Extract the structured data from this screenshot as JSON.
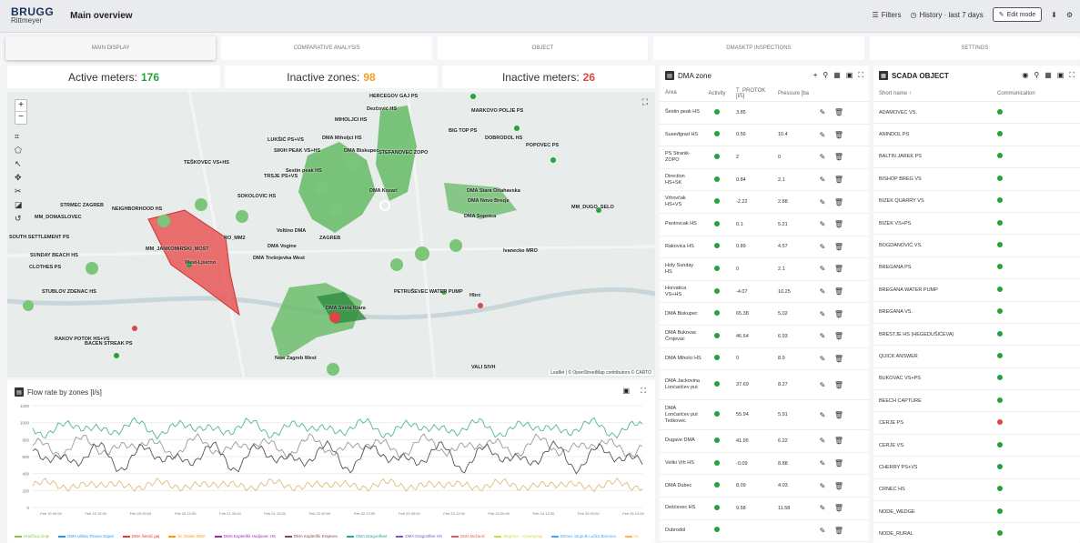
{
  "header": {
    "logo_top": "BRUGG",
    "logo_bottom": "Rittmeyer",
    "title": "Main overview",
    "filters_label": "Filters",
    "history_label": "History · last 7 days",
    "edit_mode_label": "Edit mode"
  },
  "tabs": [
    {
      "label": "MAIN DISPLAY"
    },
    {
      "label": "COMPARATIVE ANALYSIS"
    },
    {
      "label": "OBJECT"
    },
    {
      "label": "DMASKTP INSPECTIONS"
    },
    {
      "label": "SETTINGS"
    }
  ],
  "kpis": {
    "active_label": "Active meters:",
    "active_value": "176",
    "active_color": "#27a13a",
    "inactive_zones_label": "Inactive zones:",
    "inactive_zones_value": "98",
    "inactive_zones_color": "#f0a020",
    "inactive_meters_label": "Inactive meters:",
    "inactive_meters_value": "26",
    "inactive_meters_color": "#e04444"
  },
  "map": {
    "attribution": "Leaflet | © OpenStreetMap contributors © CARTO",
    "labels": [
      "HERCEGOV GAJ PS",
      "Dezčović HS",
      "MARKOVO POLJE PS",
      "MIHOLJCI HS",
      "BIG TOP PS",
      "DOBRODOL HS",
      "POPOVEC PS",
      "LUKŠIĆ PS+VS",
      "DMA Miholjci HS",
      "STEFANOVEC ZOPO",
      "SIKIH PEAK VS+HS",
      "DMA Biskupec",
      "TEŠKOVEC VS+HS",
      "TRSJE PS+VS",
      "Sestin peak HS",
      "DMA Stara Oriahavska",
      "STRMEC ZAGREB",
      "SOKOLOVIC HS",
      "DMA Kozari",
      "DMA Novo Brezje",
      "NEIGHBORHOOD HS",
      "MM_DOMASLOVEC",
      "DMA Sopnica",
      "MM_DUGO_SELO",
      "SOUTH SETTLEMENT PS",
      "RO_MM2",
      "Voltino DMA",
      "ZAGREB",
      "MM_JANKOMIRSKI_MOST",
      "DMA Vogine",
      "SUNDAY BEACH HS",
      "DMA Trešnjevka West",
      "Ivanecko MRO",
      "CLOTHES PS",
      "West-Ljsicno",
      "PETRUŠEVEC WATER PUMP",
      "STUBLOV ZDENAC HS",
      "Hbrc",
      "RAKOV POTOK HS+VS",
      "BACEN STREAK PS",
      "New Zagreb West",
      "VALI SIVH",
      "DMA Sveta Klara"
    ]
  },
  "flow": {
    "title": "Flow rate by zones [l/s]",
    "y_ticks": [
      "1200",
      "1000",
      "800",
      "600",
      "400",
      "200",
      "0"
    ],
    "x_ticks": [
      "Feb 19 00:00",
      "Feb 19 12:00",
      "Feb 20 00:00",
      "Feb 20 12:00",
      "Feb 21 00:00",
      "Feb 21 12:00",
      "Feb 22 00:00",
      "Feb 22 12:00",
      "Feb 23 00:00",
      "Feb 23 12:00",
      "Feb 24 00:00",
      "Feb 24 12:00",
      "Feb 25 00:00",
      "Feb 25 12:00"
    ],
    "legend": [
      "Hraščica Grije",
      "DMA Ulitna Trnovo Sopot",
      "DMA Šestić gaj",
      "St. Grabri DMA",
      "DMA Kuplerški Hodjovec HS",
      "DMA Kuplerški Krajevec",
      "DMA Dragonfleet",
      "DMA Dragonflee HS",
      "DMA Božanić",
      "Stoprica - st pumping",
      "Strmec Stupnik Lučko Brezovo",
      "5x"
    ],
    "legend_colors": [
      "#8bc34a",
      "#2196f3",
      "#e53935",
      "#ff9800",
      "#9c27b0",
      "#795548",
      "#26a69a",
      "#7e57c2",
      "#ef5350",
      "#cddc39",
      "#42a5f5",
      "#ffb74d"
    ]
  },
  "dma": {
    "title": "DMA zone",
    "headers": {
      "area": "Area",
      "activity": "Activity",
      "t_protok": "T_PROTOK [l/s]",
      "pressure": "Pressure [ba"
    },
    "rows": [
      {
        "area": "Šestin peak HS",
        "t": "3.85",
        "p": ""
      },
      {
        "area": "Sueeđgrad HS",
        "t": "0.56",
        "p": "10.4"
      },
      {
        "area": "PS Stranik-ZOPO",
        "t": "2",
        "p": "0"
      },
      {
        "area": "Direction HS+SK",
        "t": "0.84",
        "p": "2.1"
      },
      {
        "area": "Vrhovčak HS+VS",
        "t": "-2.22",
        "p": "2.88"
      },
      {
        "area": "Pantovcak HS",
        "t": "0.1",
        "p": "5.21"
      },
      {
        "area": "Rakovica HS",
        "t": "0.89",
        "p": "4.57"
      },
      {
        "area": "Holy Sunday HS",
        "t": "0",
        "p": "2.1"
      },
      {
        "area": "Horvatica VS+HS",
        "t": "-4.07",
        "p": "10.25"
      },
      {
        "area": "DMA Biskupec",
        "t": "65.38",
        "p": "5.02"
      },
      {
        "area": "DMA Bukovac Črnjevac",
        "t": "46.64",
        "p": "6.93"
      },
      {
        "area": "DMA Miholci HS",
        "t": "0",
        "p": "8.9"
      },
      {
        "area": "DMA Jackovina Lonćarićev put",
        "t": "37.69",
        "p": "8.27"
      },
      {
        "area": "DMA Lončarićev put Teškovec",
        "t": "55.94",
        "p": "5.91"
      },
      {
        "area": "Dugave DMA",
        "t": "41.95",
        "p": "6.22"
      },
      {
        "area": "Veliki Vrh HS",
        "t": "-0.09",
        "p": "8.88"
      },
      {
        "area": "DMA Dubec",
        "t": "8.09",
        "p": "4.03"
      },
      {
        "area": "Dešćevec HS",
        "t": "9.58",
        "p": "11.58"
      },
      {
        "area": "Dubrodol",
        "t": "",
        "p": ""
      }
    ]
  },
  "scada": {
    "title": "SCADA OBJECT",
    "headers": {
      "name": "Short name ↑",
      "comm": "Communication"
    },
    "rows": [
      {
        "name": "ADAMOVEC VS.",
        "status": "ok"
      },
      {
        "name": "ANINDOL PS",
        "status": "ok"
      },
      {
        "name": "BALTIN JAREK PS",
        "status": "ok"
      },
      {
        "name": "BISHOP BREG VS",
        "status": "ok"
      },
      {
        "name": "BIZEK QUARRY VS",
        "status": "ok"
      },
      {
        "name": "BIZEK VS+PS",
        "status": "ok"
      },
      {
        "name": "BOGDANOVIĆ VS.",
        "status": "ok"
      },
      {
        "name": "BREGANA PS",
        "status": "ok"
      },
      {
        "name": "BREGANA WATER PUMP",
        "status": "ok"
      },
      {
        "name": "BREGANA VS.",
        "status": "ok"
      },
      {
        "name": "BRESTJE HS (HEGEDUŠIĆEVA)",
        "status": "ok"
      },
      {
        "name": "QUICK ANSWER",
        "status": "ok"
      },
      {
        "name": "BUKOVAC VS+PS",
        "status": "ok"
      },
      {
        "name": "BEECH CAPTURE",
        "status": "ok"
      },
      {
        "name": "CERJE PS",
        "status": "error"
      },
      {
        "name": "CERJE VS.",
        "status": "ok"
      },
      {
        "name": "CHERRY PS+VS",
        "status": "ok"
      },
      {
        "name": "CRNEC HS",
        "status": "ok"
      },
      {
        "name": "NODE_WEDGE",
        "status": "ok"
      },
      {
        "name": "NODE_RURAL",
        "status": "ok"
      }
    ]
  },
  "colors": {
    "ok": "#27a13a",
    "error": "#e04444",
    "zone_green": "#5cb85c",
    "zone_red": "#e85858"
  }
}
